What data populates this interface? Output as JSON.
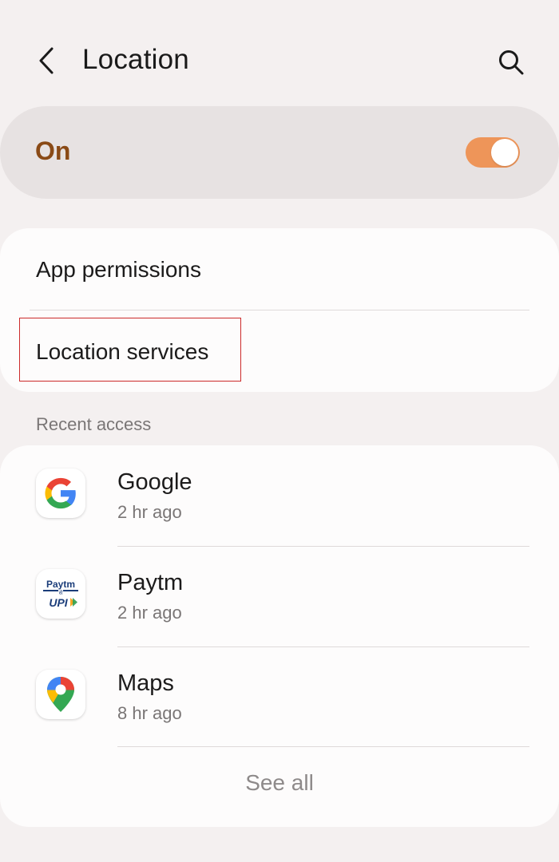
{
  "header": {
    "title": "Location",
    "back_icon": "chevron-left-icon",
    "search_icon": "search-icon"
  },
  "master_toggle": {
    "label": "On",
    "checked": true,
    "accent_color": "#ee9559",
    "label_color": "#8a4a16"
  },
  "settings": {
    "items": [
      {
        "label": "App permissions"
      },
      {
        "label": "Location services"
      }
    ]
  },
  "recent_access": {
    "section_title": "Recent access",
    "apps": [
      {
        "name": "Google",
        "time": "2 hr ago",
        "icon": "google-logo-icon"
      },
      {
        "name": "Paytm",
        "time": "2 hr ago",
        "icon": "paytm-upi-icon",
        "icon_text_top": "Paytm",
        "icon_text_mid": "से",
        "icon_text_bottom": "UPI"
      },
      {
        "name": "Maps",
        "time": "8 hr ago",
        "icon": "maps-pin-icon"
      }
    ],
    "see_all_label": "See all"
  },
  "highlight_color": "#cc2a2a"
}
